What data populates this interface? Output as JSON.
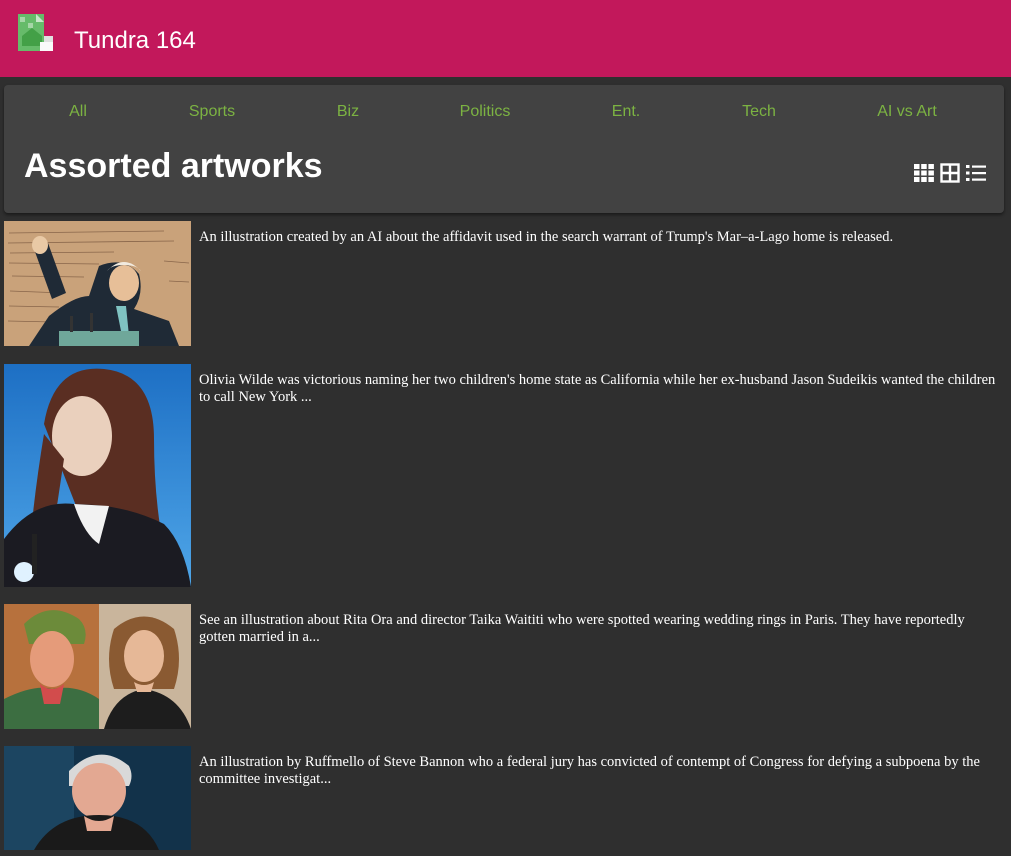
{
  "app": {
    "title": "Tundra 164"
  },
  "nav": {
    "items": [
      {
        "label": "All"
      },
      {
        "label": "Sports"
      },
      {
        "label": "Biz"
      },
      {
        "label": "Politics"
      },
      {
        "label": "Ent."
      },
      {
        "label": "Tech"
      },
      {
        "label": "AI vs Art"
      }
    ]
  },
  "page": {
    "title": "Assorted artworks"
  },
  "view_modes": [
    "grid-small-icon",
    "grid-large-icon",
    "list-icon"
  ],
  "colors": {
    "topbar": "#c2185b",
    "nav_link": "#7cb342",
    "card": "#424242",
    "background": "#2f2f2f"
  },
  "articles": [
    {
      "caption": "An illustration created by an AI about the affidavit used in the search warrant of Trump's Mar–a-Lago home is released."
    },
    {
      "caption": "Olivia Wilde was victorious naming her two children's home state as California while her ex-husband Jason Sudeikis wanted the children to call New York ..."
    },
    {
      "caption": "See an illustration about Rita Ora and director Taika Waititi who were spotted wearing wedding rings in Paris. They have reportedly gotten married in a..."
    },
    {
      "caption": "An illustration by Ruffmello of Steve Bannon who a federal jury has convicted of contempt of Congress for defying a subpoena by the committee investigat..."
    }
  ]
}
